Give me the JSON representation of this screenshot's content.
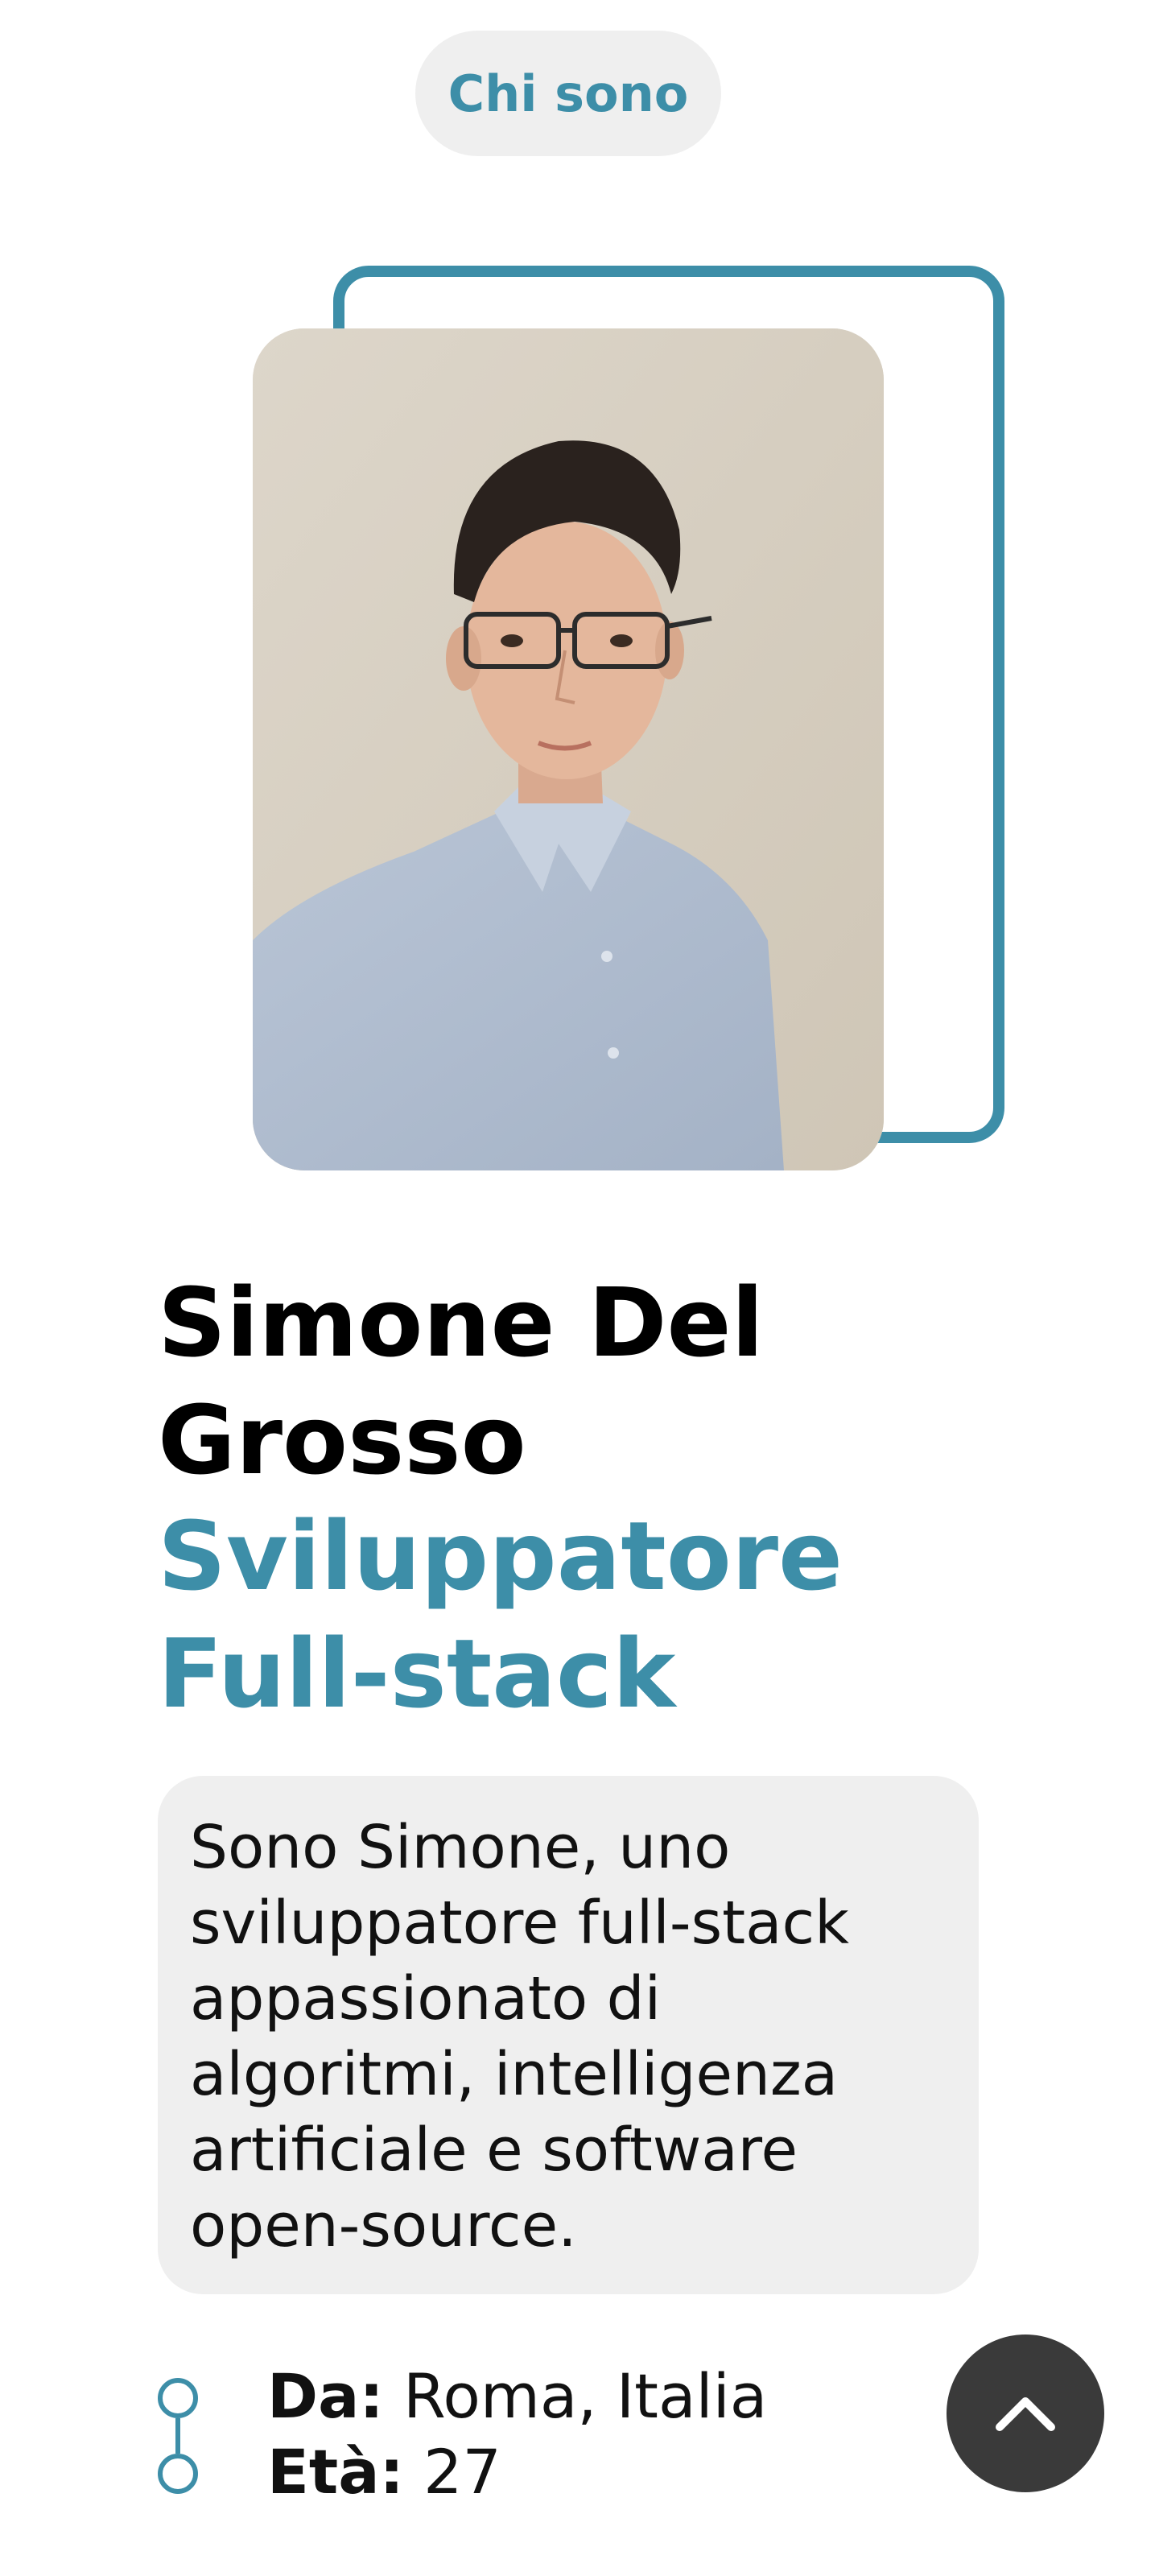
{
  "section": {
    "title": "Chi sono"
  },
  "profile": {
    "photo_alt": "Foto di Simone Del Grosso",
    "name": "Simone Del Grosso",
    "role": "Sviluppatore Full-stack",
    "bio": "Sono Simone, uno sviluppatore full-stack appassionato di algoritmi, intelligenza artificiale e software open-source."
  },
  "facts": [
    {
      "label": "Da:",
      "value": "Roma, Italia"
    },
    {
      "label": "Età:",
      "value": "27"
    }
  ],
  "colors": {
    "accent": "#3d8ea8",
    "pill_background": "#efefef",
    "card_background": "#efefef",
    "fab_background": "#3a3a3a"
  },
  "icons": {
    "scroll_top": "chevron-up-icon",
    "fact_marker": "timeline-circle-icon"
  }
}
